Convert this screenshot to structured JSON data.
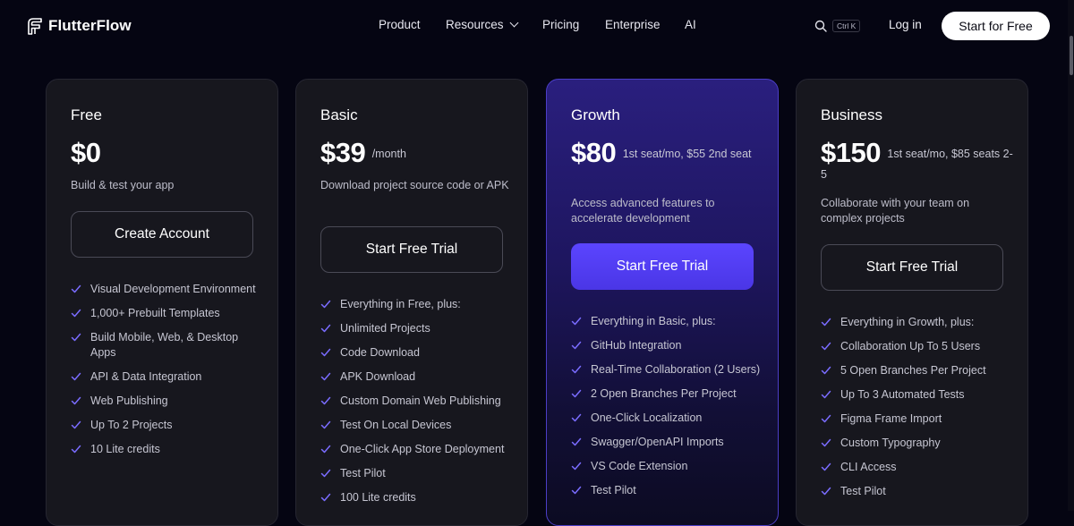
{
  "brand": {
    "name": "FlutterFlow"
  },
  "nav": {
    "links": [
      "Product",
      "Resources",
      "Pricing",
      "Enterprise",
      "AI"
    ],
    "shortcut": "Ctrl K",
    "login": "Log in",
    "cta": "Start for Free"
  },
  "colors": {
    "background": "#050512",
    "accent": "#5b45ff",
    "card": "#17171e",
    "check": "#7a6cff"
  },
  "plans": [
    {
      "name": "Free",
      "price": "$0",
      "price_suffix": "",
      "description": "Build & test your app",
      "cta": "Create Account",
      "features": [
        "Visual Development Environment",
        "1,000+ Prebuilt Templates",
        "Build Mobile, Web, & Desktop Apps",
        "API & Data Integration",
        "Web Publishing",
        "Up To 2 Projects",
        "10 Lite credits"
      ]
    },
    {
      "name": "Basic",
      "price": "$39",
      "price_suffix": "/month",
      "description": "Download project source code or APK",
      "cta": "Start Free Trial",
      "features": [
        "Everything in Free, plus:",
        "Unlimited Projects",
        "Code Download",
        "APK Download",
        "Custom Domain Web Publishing",
        "Test On Local Devices",
        "One-Click App Store Deployment",
        "Test Pilot",
        "100 Lite credits"
      ]
    },
    {
      "name": "Growth",
      "price": "$80",
      "price_suffix": "1st seat/mo, $55 2nd seat",
      "description": "Access advanced features to accelerate development",
      "cta": "Start Free Trial",
      "features": [
        "Everything in Basic, plus:",
        "GitHub Integration",
        "Real-Time Collaboration (2 Users)",
        "2 Open Branches Per Project",
        "One-Click Localization",
        "Swagger/OpenAPI Imports",
        "VS Code Extension",
        "Test Pilot"
      ]
    },
    {
      "name": "Business",
      "price": "$150",
      "price_suffix": "1st seat/mo, $85 seats 2-5",
      "description": "Collaborate with your team on complex projects",
      "cta": "Start Free Trial",
      "features": [
        "Everything in Growth, plus:",
        "Collaboration Up To 5 Users",
        "5 Open Branches Per Project",
        "Up To 3 Automated Tests",
        "Figma Frame Import",
        "Custom Typography",
        "CLI Access",
        "Test Pilot"
      ]
    }
  ]
}
